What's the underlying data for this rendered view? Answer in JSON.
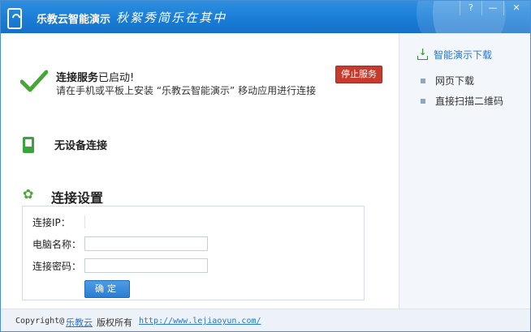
{
  "app": {
    "title": "乐教云智能演示",
    "slogan": "秋絮秀简乐在其中"
  },
  "window_controls": {
    "help": "?",
    "minimize": "—",
    "close": "✕"
  },
  "status": {
    "title_bold": "连接服务",
    "title_rest": "已启动!",
    "description": "请在手机或平板上安装 “乐教云智能演示” 移动应用进行连接",
    "stop_button": "停止服务"
  },
  "device": {
    "text": "无设备连接"
  },
  "settings": {
    "title": "连接设置",
    "ip_label": "连接IP：",
    "ip_value": "",
    "computer_name_label": "电脑名称：",
    "computer_name_value": "",
    "password_label": "连接密码：",
    "password_value": "",
    "confirm_button": "确定"
  },
  "sidebar": {
    "download_title": "智能演示下载",
    "items": [
      {
        "label": "网页下载"
      },
      {
        "label": "直接扫描二维码"
      }
    ]
  },
  "footer": {
    "copyright": "Copyright@",
    "brand": "乐教云",
    "rights": "版权所有",
    "url": "http://www.lejiaoyun.com/"
  },
  "colors": {
    "title_bar": "#1a7dd6",
    "accent_green": "#4aa83a",
    "stop_red": "#c63b2d",
    "link_blue": "#2a75c8"
  }
}
